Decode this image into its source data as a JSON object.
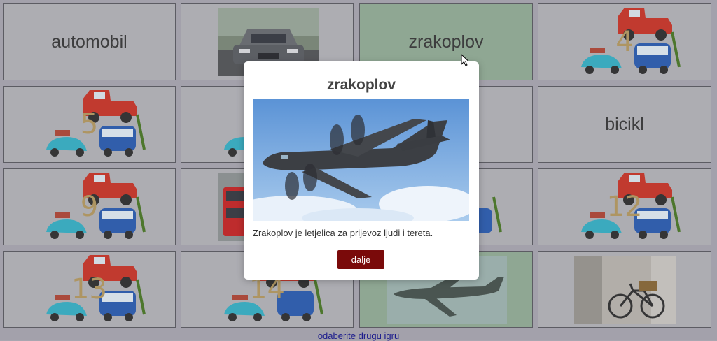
{
  "game": {
    "cards": [
      {
        "kind": "word",
        "text": "automobil",
        "matched": false
      },
      {
        "kind": "image",
        "subject": "car-photo",
        "matched": false
      },
      {
        "kind": "word",
        "text": "zrakoplov",
        "matched": true
      },
      {
        "kind": "back",
        "number": "4"
      },
      {
        "kind": "back",
        "number": "5"
      },
      {
        "kind": "back",
        "number": ""
      },
      {
        "kind": "hidden"
      },
      {
        "kind": "word",
        "text": "bicikl",
        "matched": false
      },
      {
        "kind": "back",
        "number": "9"
      },
      {
        "kind": "image",
        "subject": "bus-photo",
        "matched": false
      },
      {
        "kind": "hidden"
      },
      {
        "kind": "back",
        "number": "12"
      },
      {
        "kind": "back",
        "number": "13"
      },
      {
        "kind": "back",
        "number": "14"
      },
      {
        "kind": "image",
        "subject": "airplane-photo",
        "matched": true
      },
      {
        "kind": "image",
        "subject": "bicycle-photo",
        "matched": false
      }
    ]
  },
  "modal": {
    "title": "zrakoplov",
    "description": "Zrakoplov je letjelica za prijevoz ljudi i tereta.",
    "button_label": "dalje",
    "image": "airplane-photo"
  },
  "footer": {
    "link_label": "odaberite drugu igru"
  },
  "colors": {
    "matched_bg": "#93ad96",
    "button_bg": "#7a0a0a",
    "card_bg": "#b3b3b7"
  }
}
